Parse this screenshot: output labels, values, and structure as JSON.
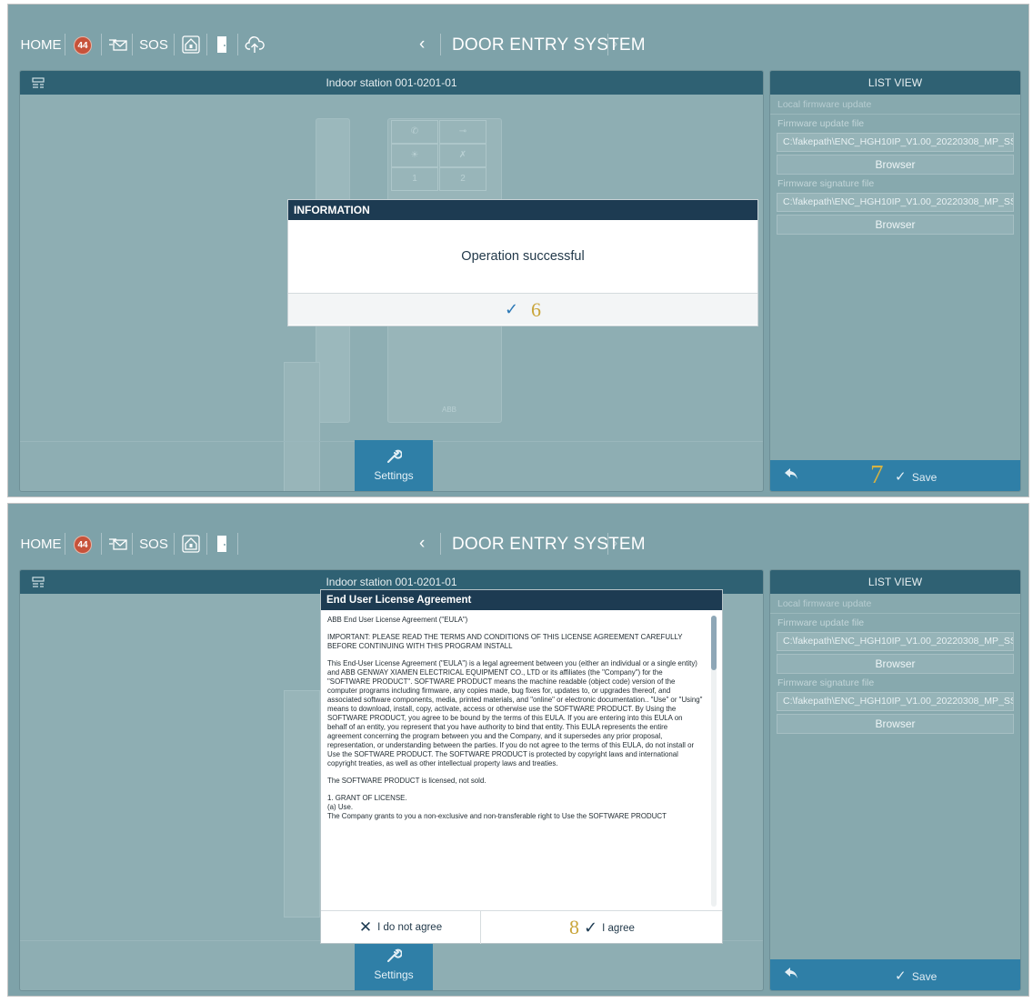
{
  "topbar": {
    "home": "HOME",
    "badge_count": "44",
    "sos": "SOS",
    "title": "DOOR ENTRY SYSTEM",
    "chevron_left": "‹",
    "chevron_right": "›"
  },
  "main": {
    "header_title": "Indoor station 001-0201-01",
    "settings_label": "Settings",
    "device_logo": "ABB",
    "device_keys": [
      "1",
      "2"
    ]
  },
  "right_panel": {
    "header": "LIST VIEW",
    "section": "Local firmware update",
    "firmware_update_label": "Firmware update file",
    "firmware_update_value": "C:\\fakepath\\ENC_HGH10IP_V1.00_20220308_MP_SS",
    "browser_label": "Browser",
    "firmware_signature_label": "Firmware signature file",
    "firmware_signature_value": "C:\\fakepath\\ENC_HGH10IP_V1.00_20220308_MP_SS",
    "save_label": "Save",
    "step_save": "7"
  },
  "info_dialog": {
    "title": "INFORMATION",
    "message": "Operation successful",
    "ok_glyph": "✓",
    "step": "6"
  },
  "eula": {
    "title": "End User License Agreement",
    "paragraphs": [
      "ABB End User License Agreement (\"EULA\")",
      "IMPORTANT: PLEASE READ THE TERMS AND CONDITIONS OF THIS LICENSE AGREEMENT CAREFULLY BEFORE CONTINUING WITH THIS PROGRAM INSTALL",
      "This End-User License Agreement (\"EULA\") is a legal agreement between you (either an individual or a single entity) and ABB GENWAY XIAMEN ELECTRICAL EQUIPMENT CO., LTD or its affiliates (the \"Company\") for the \"SOFTWARE PRODUCT\". SOFTWARE PRODUCT means the machine readable (object code) version of the computer programs including firmware, any copies made, bug fixes for, updates to, or upgrades thereof, and associated software components, media, printed materials, and \"online\" or electronic documentation.. \"Use\" or \"Using\" means to download, install, copy, activate, access or otherwise use the SOFTWARE PRODUCT. By Using the SOFTWARE PRODUCT, you agree to be bound by the terms of this EULA. If you are entering into this EULA on behalf of an entity, you represent that you have authority to bind that entity. This EULA represents the entire agreement concerning the program between you and the Company, and it supersedes any prior proposal, representation, or understanding between the parties. If you do not agree to the terms of this EULA, do not install or Use the SOFTWARE PRODUCT. The SOFTWARE PRODUCT is protected by copyright laws and international copyright treaties, as well as other intellectual property laws and treaties.",
      "The SOFTWARE PRODUCT is licensed, not sold.",
      "1. GRANT OF LICENSE.",
      "(a) Use.",
      "The Company grants to you a non-exclusive and non-transferable right to Use the SOFTWARE PRODUCT"
    ],
    "disagree_label": "I do not agree",
    "agree_label": "I agree",
    "step": "8"
  },
  "colors": {
    "screen_bg": "#7ea2a9",
    "header_bar": "#2f6173",
    "dialog_header": "#1d3b52",
    "action_blue": "#2f7fa7",
    "step_gold": "#c9a53a",
    "badge_red": "#c7523a"
  },
  "icons": {
    "mail": "mail-icon",
    "home_lock": "home-lock-icon",
    "door": "door-icon",
    "cloud_upload": "cloud-upload-icon",
    "list": "list-icon",
    "wrench": "wrench-icon",
    "back": "back-arrow-icon",
    "check": "check-icon",
    "close": "close-icon"
  }
}
